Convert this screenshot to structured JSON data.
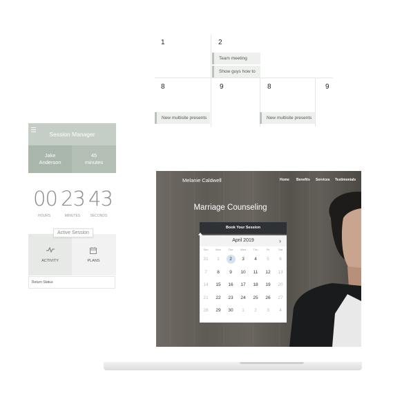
{
  "calendar": {
    "top_row": [
      "1",
      "2"
    ],
    "bottom_row": [
      "8",
      "9",
      "8",
      "9"
    ],
    "events": {
      "team_meeting": "Team meeting",
      "show_guys": "Show guys how to",
      "new_multisite_1": "New multisite presents",
      "new_multisite_2": "New multisite presents"
    }
  },
  "session_manager": {
    "title": "Session Manager",
    "user_name_line1": "Jake",
    "user_name_line2": "Anderson",
    "duration_line1": "45",
    "duration_line2": "minutes",
    "timer": {
      "hours": "00",
      "minutes": "23",
      "seconds": "43"
    },
    "timer_labels": {
      "hours": "HOURS",
      "minutes": "MINUTES",
      "seconds": "SECONDS"
    },
    "tooltip": "Active Session",
    "tabs": {
      "activity": "ACTIVITY",
      "plans": "PLANS"
    },
    "status": "Return Status",
    "colors": {
      "header": "#c4cec6",
      "user": "#a9b6ab",
      "duration": "#b3beb5"
    }
  },
  "website": {
    "name": "Melanie Caldwell",
    "nav": [
      "Home",
      "Benefits",
      "Services",
      "Testimonials"
    ],
    "hero_title": "Marriage Counseling",
    "book_button": "Book Your Session",
    "datepicker": {
      "month": "April 2019",
      "next_icon": "chevron-right-icon",
      "weekdays": [
        "Sun",
        "Mon",
        "Tue",
        "Wed",
        "Thu",
        "Fri",
        "Sat"
      ],
      "weeks": [
        [
          "31",
          "1",
          "2",
          "3",
          "4",
          "5",
          "6"
        ],
        [
          "7",
          "8",
          "9",
          "10",
          "11",
          "12",
          "13"
        ],
        [
          "14",
          "15",
          "16",
          "17",
          "18",
          "19",
          "20"
        ],
        [
          "21",
          "22",
          "23",
          "24",
          "25",
          "26",
          "27"
        ],
        [
          "28",
          "29",
          "30",
          "1",
          "2",
          "3",
          "4"
        ]
      ],
      "muted_cells": [
        "0-0",
        "0-1",
        "0-5",
        "0-6",
        "1-0",
        "1-6",
        "2-0",
        "2-6",
        "3-0",
        "3-6",
        "4-0",
        "4-3",
        "4-4",
        "4-5",
        "4-6"
      ],
      "selected": "2",
      "selected_color": "#d4e3ef"
    }
  }
}
